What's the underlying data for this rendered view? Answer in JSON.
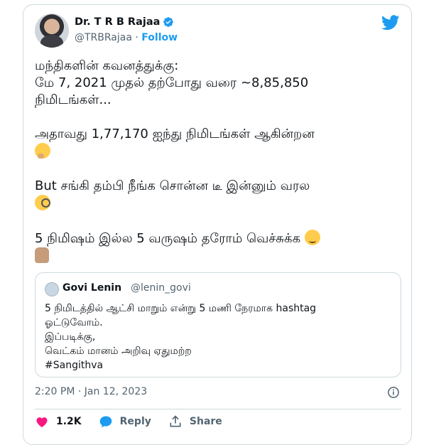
{
  "author": {
    "name": "Dr. T R B Rajaa",
    "handle": "@TRBRajaa",
    "separator": "·",
    "follow_label": "Follow"
  },
  "tweet": {
    "lines": [
      "மந்திகளின் கவனத்துக்கு:",
      "மே 7, 2021 முதல் தற்போது வரை ~8,85,850",
      "நிமிடங்கள்...",
      "அதாவது 1,77,170 ஐந்து நிமிடங்கள் ஆகின்றன",
      "But சங்கி தம்பி நீங்க சொன்ன டீ இன்னும் வரல",
      "5 நிமிஷம் இல்ல 5 வருஷம் தரோம் வெச்சுக்க"
    ]
  },
  "quote": {
    "name": "Govi Lenin",
    "handle": "@lenin_govi",
    "lines": [
      "5 நிமிடத்தில் ஆட்சி மாறும் என்று 5 மணி நேரமாக hashtag",
      "ஓட்டுவோம்.",
      "இப்படிக்கு,",
      "வெட்கம் மானம் அறிவு ஏதுமற்ற",
      "#Sangithva"
    ]
  },
  "meta": {
    "timestamp": "2:20 PM · Jan 12, 2023"
  },
  "actions": {
    "like_count": "1.2K",
    "reply_label": "Reply",
    "share_label": "Share"
  },
  "colors": {
    "accent": "#1d9bf0",
    "like": "#f91880",
    "text": "#0f1419",
    "muted": "#536471",
    "border": "#cfd9de"
  },
  "icons": {
    "verified": "verified-badge-icon",
    "logo": "twitter-bird-icon",
    "info": "info-icon",
    "like": "heart-icon",
    "reply": "speech-bubble-icon",
    "share": "share-upload-icon"
  }
}
